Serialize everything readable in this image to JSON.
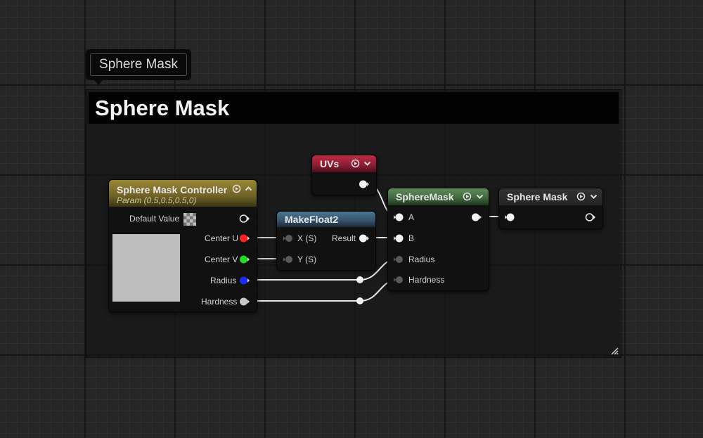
{
  "bubble": {
    "text": "Sphere Mask"
  },
  "comment": {
    "title": "Sphere Mask"
  },
  "colors": {
    "controller_header": "#8c7a2e",
    "uvs_header": "#a8233a",
    "makefloat_header": "#3f5f78",
    "spheremask_header": "#4e7a4c",
    "output_header": "#2a2a2a",
    "center_u_pin": "#ff2020",
    "center_v_pin": "#22dd22",
    "radius_pin": "#1d2bff",
    "hardness_pin": "#c8c8c8"
  },
  "nodes": {
    "controller": {
      "title": "Sphere Mask Controller",
      "subtitle": "Param (0.5,0.5,0.5,0)",
      "default_value_label": "Default Value",
      "pins": {
        "center_u": "Center U",
        "center_v": "Center V",
        "radius": "Radius",
        "hardness": "Hardness"
      },
      "header_icons": [
        "preview-toggle-icon",
        "collapse-up-icon"
      ]
    },
    "uvs": {
      "title": "UVs"
    },
    "makefloat2": {
      "title": "MakeFloat2",
      "pins": {
        "x": "X (S)",
        "y": "Y (S)",
        "result": "Result"
      }
    },
    "spheremask": {
      "title": "SphereMask",
      "pins": {
        "a": "A",
        "b": "B",
        "radius": "Radius",
        "hardness": "Hardness"
      }
    },
    "output": {
      "title": "Sphere Mask"
    }
  }
}
